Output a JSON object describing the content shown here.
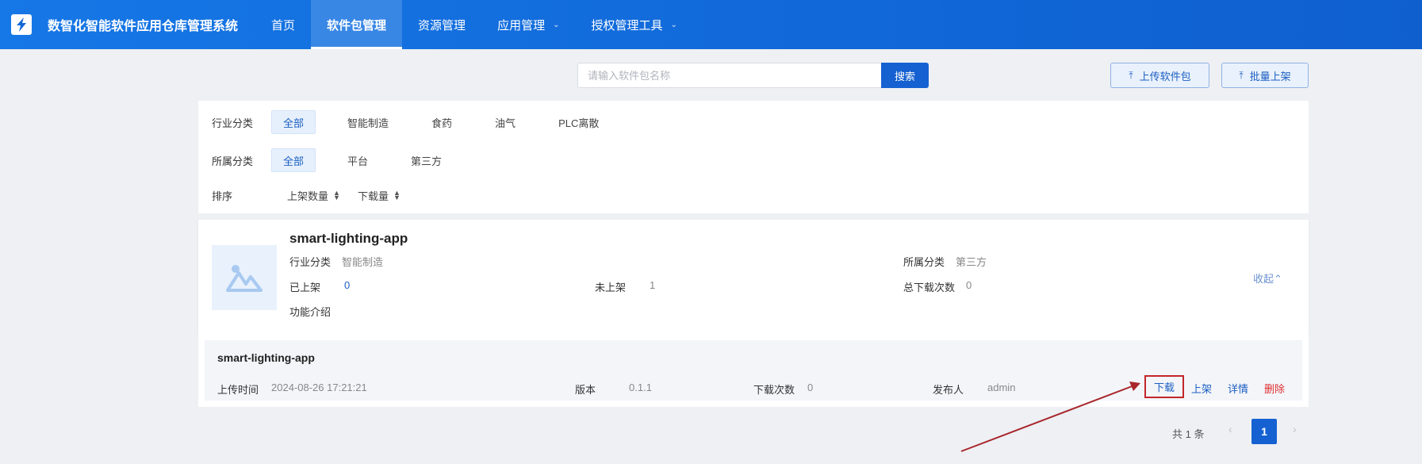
{
  "header": {
    "app_title": "数智化智能软件应用仓库管理系统",
    "nav": [
      {
        "label": "首页",
        "active": false,
        "dropdown": false
      },
      {
        "label": "软件包管理",
        "active": true,
        "dropdown": false
      },
      {
        "label": "资源管理",
        "active": false,
        "dropdown": false
      },
      {
        "label": "应用管理",
        "active": false,
        "dropdown": true
      },
      {
        "label": "授权管理工具",
        "active": false,
        "dropdown": true
      }
    ]
  },
  "toolbar": {
    "search_placeholder": "请输入软件包名称",
    "search_value": "",
    "search_label": "搜索",
    "upload_label": "上传软件包",
    "batch_label": "批量上架"
  },
  "filters": {
    "industry": {
      "label": "行业分类",
      "options": [
        "全部",
        "智能制造",
        "食药",
        "油气",
        "PLC离散"
      ],
      "selected": "全部"
    },
    "category": {
      "label": "所属分类",
      "options": [
        "全部",
        "平台",
        "第三方"
      ],
      "selected": "全部"
    },
    "sort": {
      "label": "排序",
      "options": [
        "上架数量",
        "下载量"
      ]
    }
  },
  "package": {
    "name": "smart-lighting-app",
    "industry_label": "行业分类",
    "industry_value": "智能制造",
    "category_label": "所属分类",
    "category_value": "第三方",
    "listed_label": "已上架",
    "listed_value": "0",
    "unlisted_label": "未上架",
    "unlisted_value": "1",
    "downloads_label": "总下载次数",
    "downloads_value": "0",
    "intro_label": "功能介绍",
    "collapse_label": "收起"
  },
  "version": {
    "name": "smart-lighting-app",
    "upload_time_label": "上传时间",
    "upload_time_value": "2024-08-26 17:21:21",
    "version_label": "版本",
    "version_value": "0.1.1",
    "downloads_label": "下载次数",
    "downloads_value": "0",
    "publisher_label": "发布人",
    "publisher_value": "admin",
    "actions": {
      "download": "下载",
      "list": "上架",
      "detail": "详情",
      "delete": "删除"
    }
  },
  "pagination": {
    "total_text": "共 1 条",
    "current_page": "1"
  },
  "colors": {
    "primary": "#1561d2",
    "header": "#1168d8",
    "danger": "#e03131",
    "annotation": "#a8262b"
  }
}
